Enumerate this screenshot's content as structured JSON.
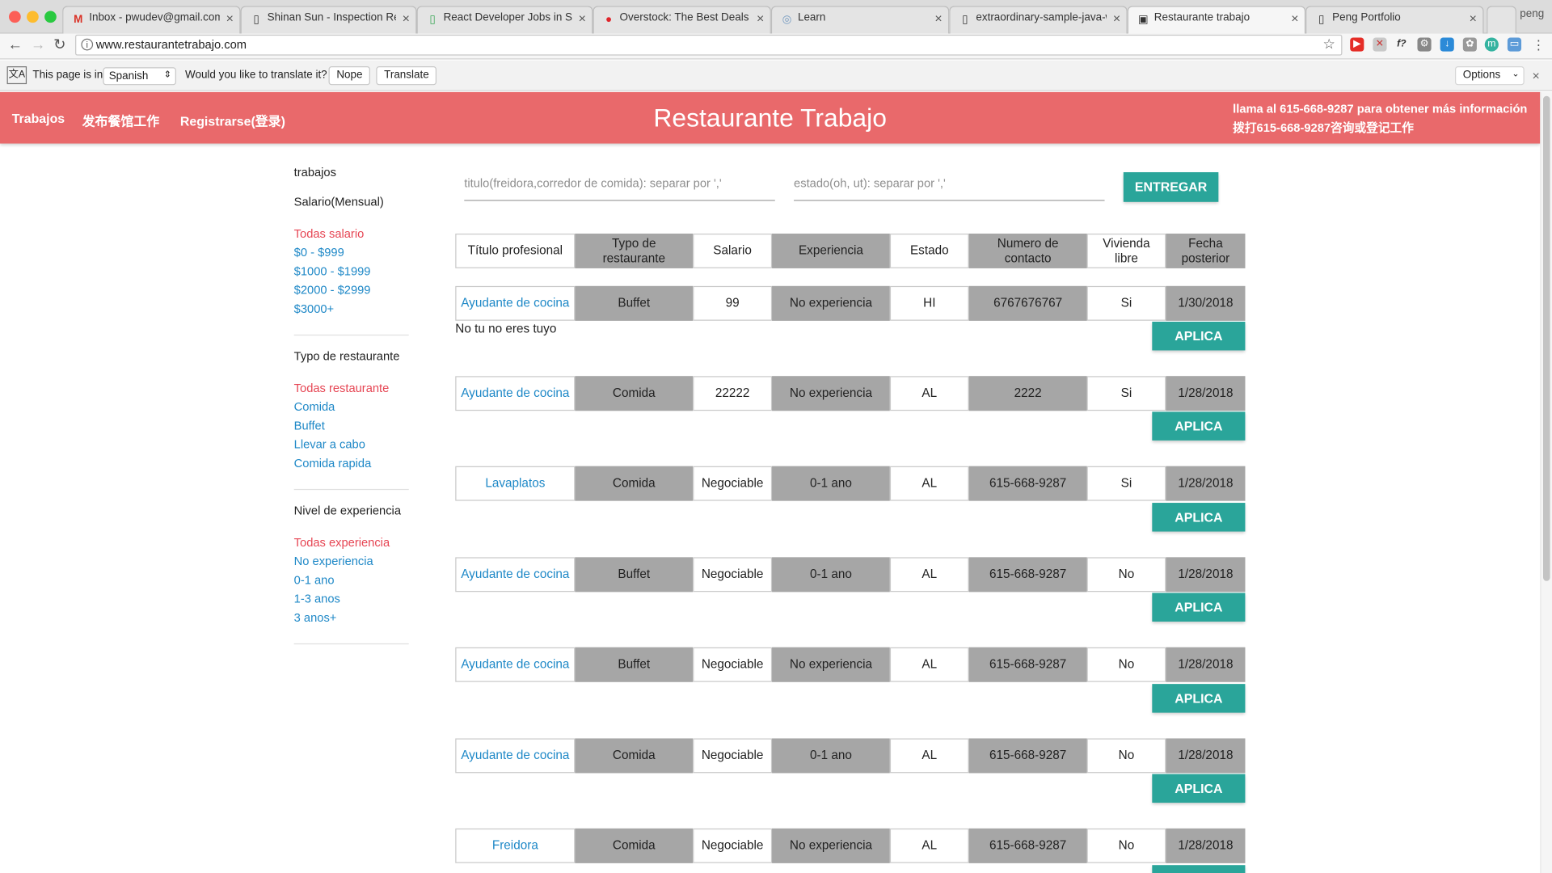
{
  "browser": {
    "tabs": [
      {
        "title": "Inbox - pwudev@gmail.com -",
        "icon": "gmail-icon"
      },
      {
        "title": "Shinan Sun - Inspection Repo",
        "icon": "document-icon"
      },
      {
        "title": "React Developer Jobs in Salt",
        "icon": "document-icon"
      },
      {
        "title": "Overstock: The Best Deals O",
        "icon": "overstock-icon"
      },
      {
        "title": "Learn",
        "icon": "globe-icon"
      },
      {
        "title": "extraordinary-sample-java-w",
        "icon": "document-icon"
      },
      {
        "title": "Restaurante trabajo",
        "icon": "site-icon"
      },
      {
        "title": "Peng Portfolio",
        "icon": "document-icon"
      }
    ],
    "profile": "peng",
    "url": "www.restaurantetrabajo.com",
    "translate": {
      "prefix": "This page is in",
      "language": "Spanish",
      "question": "Would you like to translate it?",
      "nope": "Nope",
      "translate": "Translate",
      "options": "Options"
    }
  },
  "header": {
    "nav": [
      "Trabajos",
      "发布餐馆工作",
      "Registrarse(登录)"
    ],
    "title": "Restaurante Trabajo",
    "info_line1": "llama al 615-668-9287 para obtener más información",
    "info_line2": "拨打615-668-9287咨询或登记工作",
    "color": "#e9696b"
  },
  "sidebar": {
    "title": "trabajos",
    "salary": {
      "heading": "Salario(Mensual)",
      "items": [
        "Todas salario",
        "$0 - $999",
        "$1000 - $1999",
        "$2000 - $2999",
        "$3000+"
      ]
    },
    "restaurant": {
      "heading": "Typo de restaurante",
      "items": [
        "Todas restaurante",
        "Comida",
        "Buffet",
        "Llevar a cabo",
        "Comida rapida"
      ]
    },
    "experience": {
      "heading": "Nivel de experiencia",
      "items": [
        "Todas experiencia",
        "No experiencia",
        "0-1 ano",
        "1-3 anos",
        "3 anos+"
      ]
    }
  },
  "search": {
    "title_placeholder": "titulo(freidora,corredor de comida): separar por ','",
    "state_placeholder": "estado(oh, ut): separar por ','",
    "submit": "ENTREGAR"
  },
  "table": {
    "headers": [
      "Título profesional",
      "Typo de restaurante",
      "Salario",
      "Experiencia",
      "Estado",
      "Numero de contacto",
      "Vivienda libre",
      "Fecha posterior"
    ],
    "apply_label": "APLICA",
    "rows": [
      {
        "title": "Ayudante de cocina",
        "type": "Buffet",
        "salary": "99",
        "experience": "No experiencia",
        "state": "HI",
        "contact": "6767676767",
        "housing": "Si",
        "date": "1/30/2018",
        "note": "No tu no eres tuyo"
      },
      {
        "title": "Ayudante de cocina",
        "type": "Comida",
        "salary": "22222",
        "experience": "No experiencia",
        "state": "AL",
        "contact": "2222",
        "housing": "Si",
        "date": "1/28/2018"
      },
      {
        "title": "Lavaplatos",
        "type": "Comida",
        "salary": "Negociable",
        "experience": "0-1 ano",
        "state": "AL",
        "contact": "615-668-9287",
        "housing": "Si",
        "date": "1/28/2018"
      },
      {
        "title": "Ayudante de cocina",
        "type": "Buffet",
        "salary": "Negociable",
        "experience": "0-1 ano",
        "state": "AL",
        "contact": "615-668-9287",
        "housing": "No",
        "date": "1/28/2018"
      },
      {
        "title": "Ayudante de cocina",
        "type": "Buffet",
        "salary": "Negociable",
        "experience": "No experiencia",
        "state": "AL",
        "contact": "615-668-9287",
        "housing": "No",
        "date": "1/28/2018"
      },
      {
        "title": "Ayudante de cocina",
        "type": "Comida",
        "salary": "Negociable",
        "experience": "0-1 ano",
        "state": "AL",
        "contact": "615-668-9287",
        "housing": "No",
        "date": "1/28/2018"
      },
      {
        "title": "Freidora",
        "type": "Comida",
        "salary": "Negociable",
        "experience": "No experiencia",
        "state": "AL",
        "contact": "615-668-9287",
        "housing": "No",
        "date": "1/28/2018"
      }
    ]
  },
  "colors": {
    "accent": "#2aa59a",
    "link": "#1e88c7",
    "active_filter": "#e64553",
    "cell_gray": "#a6a6a6"
  }
}
